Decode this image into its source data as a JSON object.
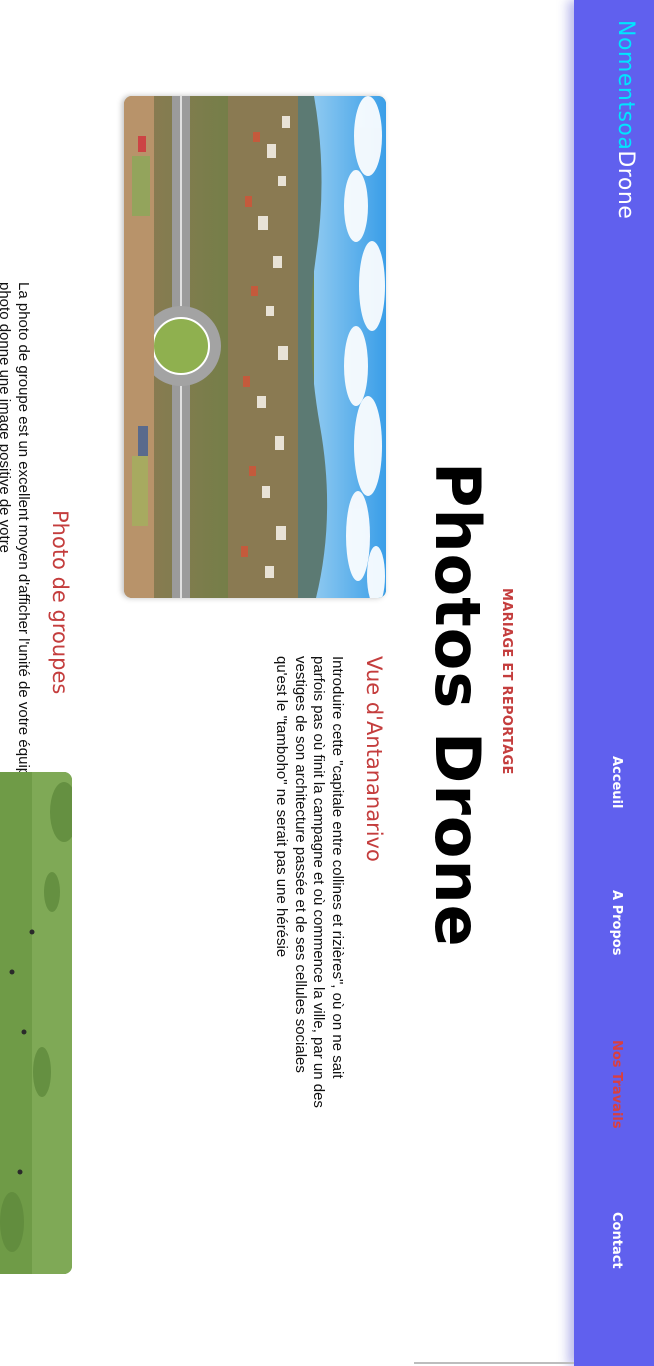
{
  "nav": {
    "brand_part1": "Nomentsoa",
    "brand_part2": "Drone",
    "links": [
      "Acceuil",
      "A Propos",
      "Nos Travails",
      "Contact"
    ],
    "active_link": "Nos Travails"
  },
  "hero": {
    "kicker": "MARIAGE ET REPORTAGE",
    "title": "Photos Drone"
  },
  "section1": {
    "heading": "Vue d'Antananarivo",
    "text": "Introduire cette \"capitale entre collines et rizières\", où on ne sait parfois pas où finit la campagne et où commence la ville, par un des vestiges de son architecture passée et de ses cellules sociales qu'est le \"tamboho\" ne serait pas une hérésie"
  },
  "section2": {
    "heading": "Photo de groupes",
    "text": "La photo de groupe est un excellent moyen d'afficher l'unité de votre équipe ! Cette photo donne une image positive de votre"
  },
  "colors": {
    "nav_bg": "#6060ee",
    "brand_accent": "#00e5ff",
    "accent_red": "#c43d3d"
  }
}
